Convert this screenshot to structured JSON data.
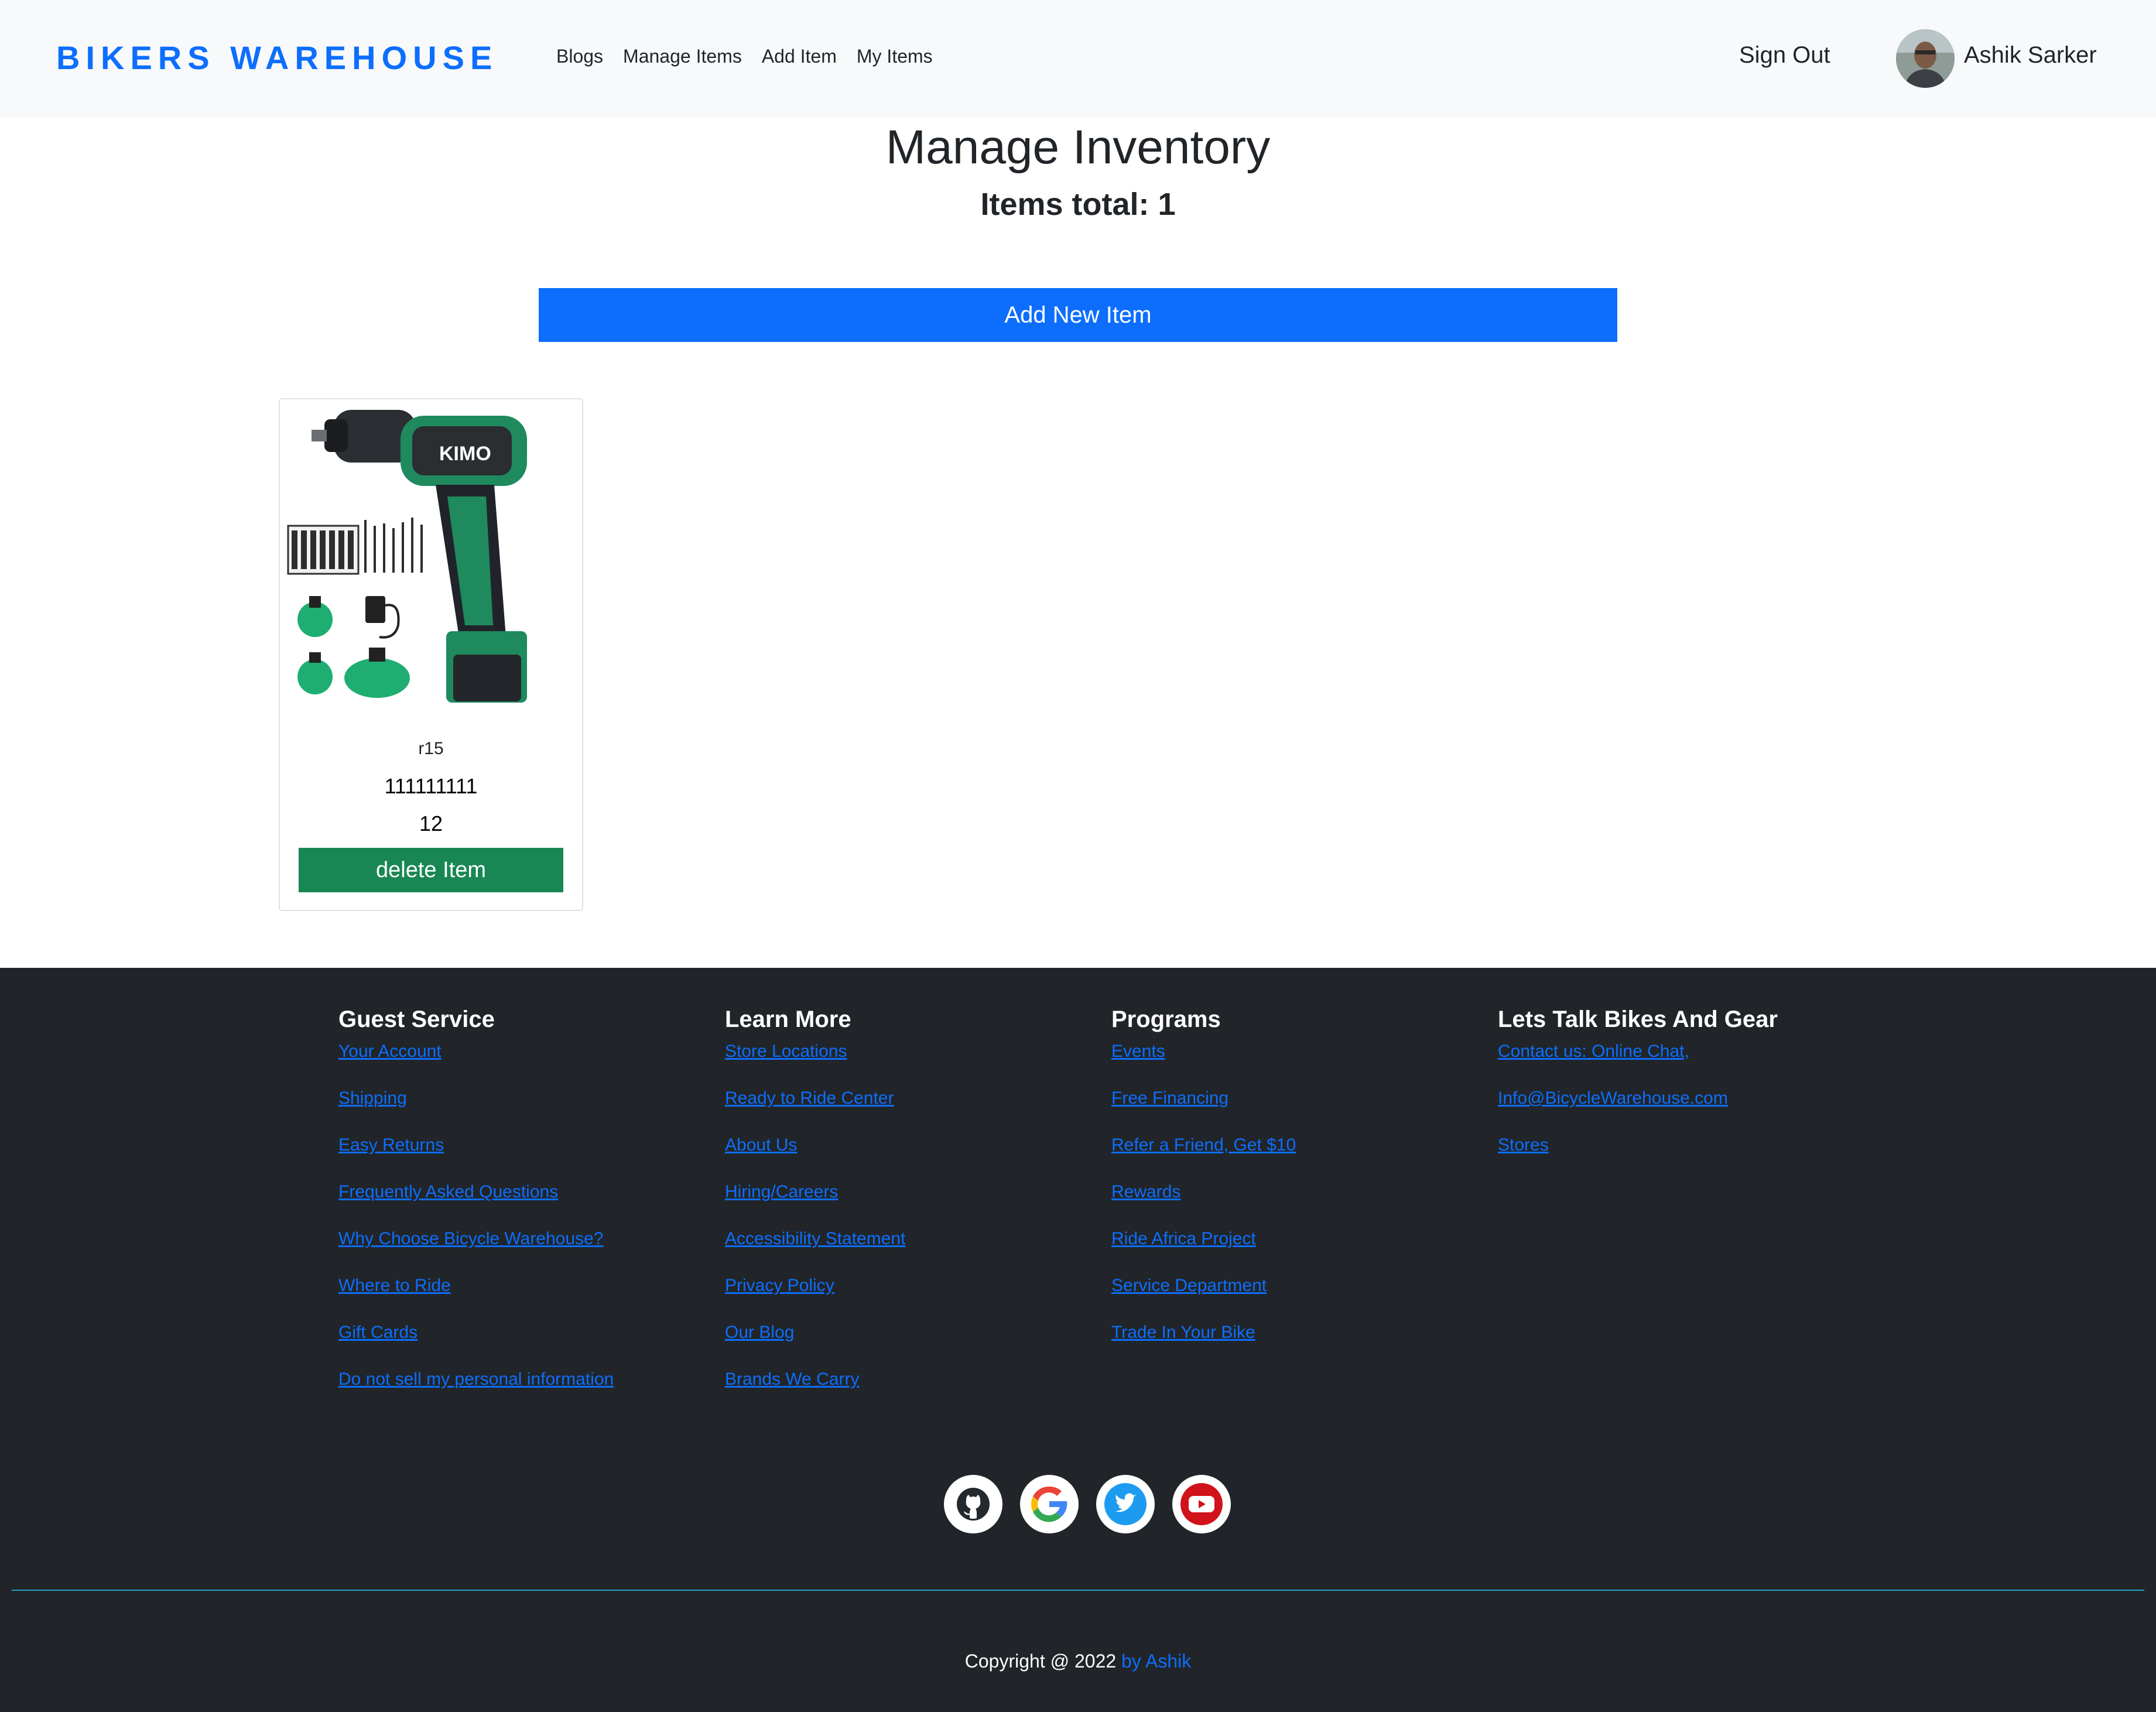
{
  "navbar": {
    "brand": "BIKERS WAREHOUSE",
    "links": [
      "Blogs",
      "Manage Items",
      "Add Item",
      "My Items"
    ],
    "sign_out": "Sign Out",
    "user_name": "Ashik Sarker"
  },
  "main": {
    "title": "Manage Inventory",
    "items_total": "Items total: 1",
    "add_button": "Add New Item",
    "items": [
      {
        "name": "r15",
        "price": "111111111",
        "quantity": "12",
        "image_label": "KIMO",
        "delete_label": "delete Item"
      }
    ]
  },
  "footer": {
    "columns": [
      {
        "heading": "Guest Service",
        "links": [
          "Your Account",
          "Shipping",
          "Easy Returns",
          "Frequently Asked Questions",
          "Why Choose Bicycle Warehouse?",
          "Where to Ride",
          "Gift Cards",
          "Do not sell my personal information"
        ]
      },
      {
        "heading": "Learn More",
        "links": [
          "Store Locations",
          "Ready to Ride Center",
          "About Us",
          "Hiring/Careers",
          "Accessibility Statement",
          "Privacy Policy",
          "Our Blog",
          "Brands We Carry"
        ]
      },
      {
        "heading": "Programs",
        "links": [
          "Events",
          "Free Financing",
          "Refer a Friend, Get $10",
          "Rewards",
          "Ride Africa Project",
          "Service Department",
          "Trade In Your Bike"
        ]
      },
      {
        "heading": "Lets Talk Bikes And Gear",
        "links": [
          "Contact us: Online Chat,",
          "Info@BicycleWarehouse.com",
          "Stores"
        ]
      }
    ],
    "socials": [
      "github-icon",
      "google-icon",
      "twitter-icon",
      "youtube-icon"
    ],
    "copyright_prefix": "Copyright @ 2022 ",
    "copyright_by": "by Ashik"
  },
  "colors": {
    "brand": "#0d6efd",
    "primary_button": "#0d6efd",
    "success_button": "#198754",
    "footer_bg": "#212529",
    "navbar_bg": "#f8f9fa",
    "divider": "#22a2c6"
  }
}
